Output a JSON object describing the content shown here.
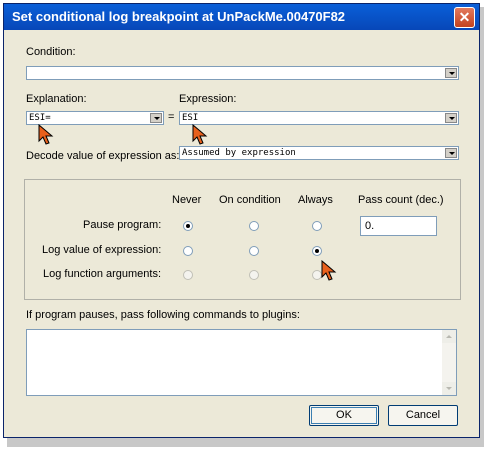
{
  "window": {
    "title": "Set conditional log breakpoint at UnPackMe.00470F82",
    "close_glyph": "✕"
  },
  "condition": {
    "label": "Condition:",
    "value": ""
  },
  "explanation": {
    "label": "Explanation:",
    "value": "ESI="
  },
  "equals_sign": "=",
  "expression": {
    "label": "Expression:",
    "value": "ESI"
  },
  "decode": {
    "label": "Decode value of expression as:",
    "value": "Assumed by expression"
  },
  "options": {
    "columns": [
      "Never",
      "On condition",
      "Always",
      "Pass count (dec.)"
    ],
    "rows": [
      {
        "label": "Pause program:",
        "selected": "Never",
        "enabled": true
      },
      {
        "label": "Log value of expression:",
        "selected": "Always",
        "enabled": true
      },
      {
        "label": "Log function arguments:",
        "selected": "",
        "enabled": false
      }
    ],
    "pass_count": "0."
  },
  "commands": {
    "label": "If program pauses, pass following commands to plugins:",
    "value": ""
  },
  "buttons": {
    "ok": "OK",
    "cancel": "Cancel"
  },
  "colors": {
    "titlebar": "#0747b8",
    "close": "#c4421e",
    "face": "#ece9d8",
    "cursor": "#e8601c"
  }
}
